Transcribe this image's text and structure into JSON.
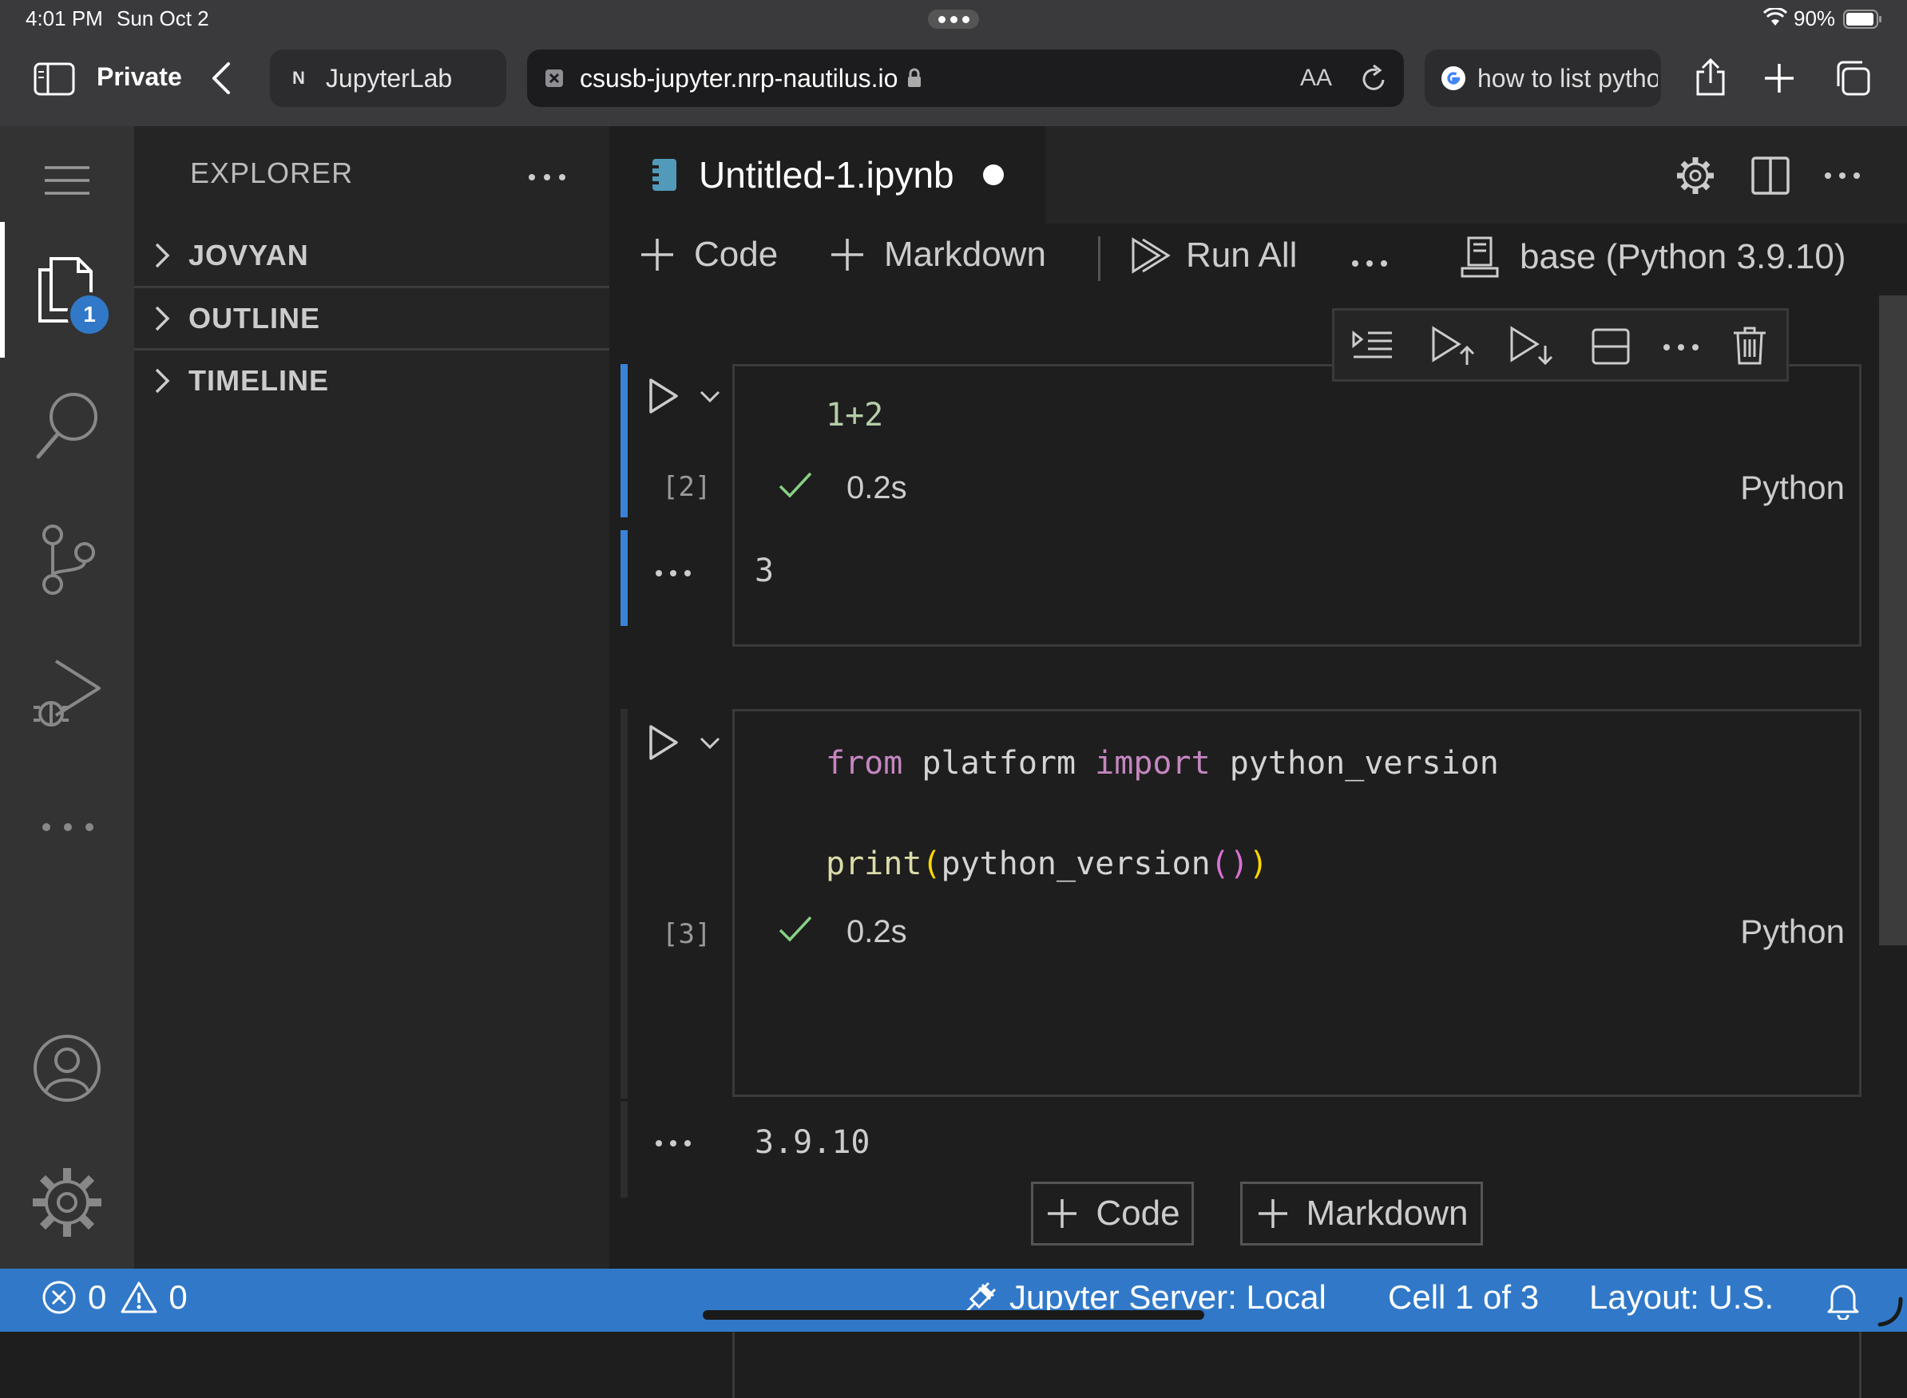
{
  "system": {
    "time": "4:01 PM",
    "date": "Sun Oct 2",
    "battery": "90%"
  },
  "browser": {
    "private_label": "Private",
    "tab1": {
      "favicon": "N",
      "label": "JupyterLab"
    },
    "address": "csusb-jupyter.nrp-nautilus.io",
    "text_size": "AA",
    "tab3": {
      "label": "how to list pytho"
    }
  },
  "sidebar": {
    "title": "EXPLORER",
    "badge": "1",
    "sections": [
      {
        "label": "JOVYAN"
      },
      {
        "label": "OUTLINE"
      },
      {
        "label": "TIMELINE"
      }
    ]
  },
  "editor": {
    "tab_title": "Untitled-1.ipynb",
    "toolbar": {
      "code": "Code",
      "markdown": "Markdown",
      "run_all": "Run All",
      "kernel": "base (Python 3.9.10)"
    }
  },
  "cells": [
    {
      "exec_count": "[2]",
      "code": "1+2",
      "duration": "0.2s",
      "language": "Python",
      "output": "3"
    },
    {
      "exec_count": "[3]",
      "code_line1": {
        "kw1": "from",
        "mod": " platform ",
        "kw2": "import",
        "name": " python_version"
      },
      "code_line2": {
        "fn": "print",
        "p1": "(",
        "inner": "python_version",
        "p2": "()",
        "p3": ")"
      },
      "duration": "0.2s",
      "language": "Python",
      "output": "3.9.10"
    }
  ],
  "insert": {
    "code": "Code",
    "markdown": "Markdown"
  },
  "status": {
    "errors": "0",
    "warnings": "0",
    "server": "Jupyter Server: Local",
    "cell": "Cell 1 of 3",
    "layout": "Layout: U.S."
  },
  "colors": {
    "accent": "#3179c8",
    "keyword": "#c586c0",
    "function": "#dcdcaa",
    "check": "#89d185",
    "focus_bar": "#3b82d6"
  }
}
